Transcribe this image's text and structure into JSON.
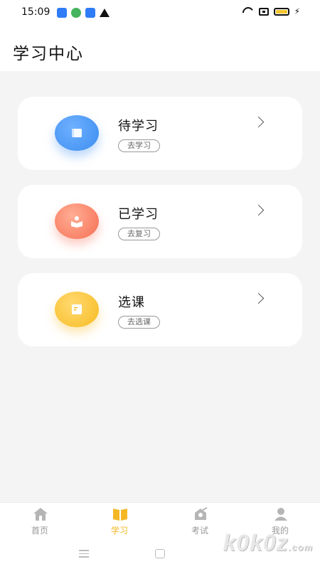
{
  "status_bar": {
    "time": "15:09"
  },
  "header": {
    "title": "学习中心"
  },
  "cards": [
    {
      "title": "待学习",
      "action": "去学习",
      "icon": "book-icon",
      "color": "#3b8df0"
    },
    {
      "title": "已学习",
      "action": "去复习",
      "icon": "reader-icon",
      "color": "#f66e52"
    },
    {
      "title": "选课",
      "action": "去选课",
      "icon": "note-icon",
      "color": "#f7bb21"
    }
  ],
  "bottom_nav": {
    "items": [
      {
        "label": "首页",
        "icon": "home-icon",
        "active": false
      },
      {
        "label": "学习",
        "icon": "open-book-icon",
        "active": true
      },
      {
        "label": "考试",
        "icon": "exam-icon",
        "active": false
      },
      {
        "label": "我的",
        "icon": "user-icon",
        "active": false
      }
    ],
    "active_color": "#f4b824",
    "inactive_color": "#999999"
  },
  "watermark": {
    "text": "k0k0z",
    "suffix": ".com"
  }
}
